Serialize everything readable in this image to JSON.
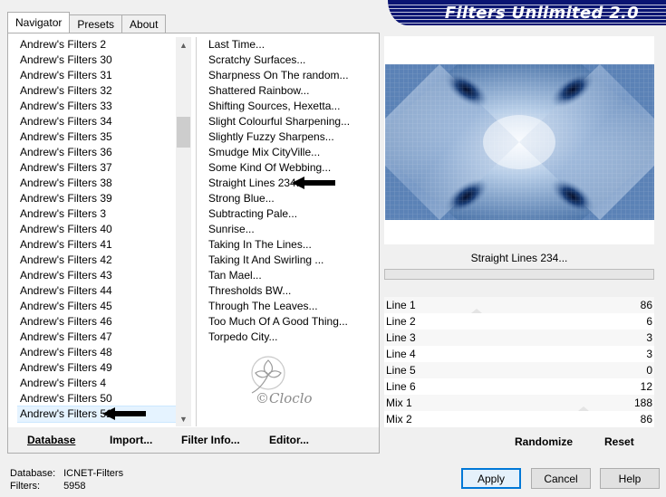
{
  "tabs": [
    {
      "label": "Navigator",
      "active": true
    },
    {
      "label": "Presets",
      "active": false
    },
    {
      "label": "About",
      "active": false
    }
  ],
  "banner_title": "Filters Unlimited 2.0",
  "categories": [
    "Andrew's Filters 2",
    "Andrew's Filters 30",
    "Andrew's Filters 31",
    "Andrew's Filters 32",
    "Andrew's Filters 33",
    "Andrew's Filters 34",
    "Andrew's Filters 35",
    "Andrew's Filters 36",
    "Andrew's Filters 37",
    "Andrew's Filters 38",
    "Andrew's Filters 39",
    "Andrew's Filters 3",
    "Andrew's Filters 40",
    "Andrew's Filters 41",
    "Andrew's Filters 42",
    "Andrew's Filters 43",
    "Andrew's Filters 44",
    "Andrew's Filters 45",
    "Andrew's Filters 46",
    "Andrew's Filters 47",
    "Andrew's Filters 48",
    "Andrew's Filters 49",
    "Andrew's Filters 4",
    "Andrew's Filters 50",
    "Andrew's Filters 51"
  ],
  "selected_category": "Andrew's Filters 51",
  "filters": [
    "Last Time...",
    "Scratchy Surfaces...",
    "Sharpness On The random...",
    "Shattered Rainbow...",
    "Shifting Sources, Hexetta...",
    "Slight Colourful Sharpening...",
    "Slightly Fuzzy Sharpens...",
    "Smudge Mix CityVille...",
    "Some Kind Of Webbing...",
    "Straight Lines 234...",
    "Strong Blue...",
    "Subtracting Pale...",
    "Sunrise...",
    "Taking In The Lines...",
    "Taking It And Swirling ...",
    "Tan Mael...",
    "Thresholds BW...",
    "Through The Leaves...",
    "Too Much Of A Good Thing...",
    "Torpedo City..."
  ],
  "selected_filter": "Straight Lines 234...",
  "list_buttons": {
    "database": "Database",
    "import": "Import...",
    "filter_info": "Filter Info...",
    "editor": "Editor..."
  },
  "params": [
    {
      "label": "Line 1",
      "value": "86"
    },
    {
      "label": "Line 2",
      "value": "6"
    },
    {
      "label": "Line 3",
      "value": "3"
    },
    {
      "label": "Line 4",
      "value": "3"
    },
    {
      "label": "Line 5",
      "value": "0"
    },
    {
      "label": "Line 6",
      "value": "12"
    },
    {
      "label": "Mix 1",
      "value": "188"
    },
    {
      "label": "Mix 2",
      "value": "86"
    }
  ],
  "randomize": "Randomize",
  "reset": "Reset",
  "footer": {
    "database_label": "Database:",
    "database_value": "ICNET-Filters",
    "filters_label": "Filters:",
    "filters_value": "5958"
  },
  "buttons": {
    "apply": "Apply",
    "cancel": "Cancel",
    "help": "Help"
  },
  "watermark_text": "Cloclo",
  "colors": {
    "banner": "#0a1472",
    "preview_dark": "#0b2a5c",
    "preview_light": "#e8f0fa",
    "accent": "#0078d7"
  }
}
